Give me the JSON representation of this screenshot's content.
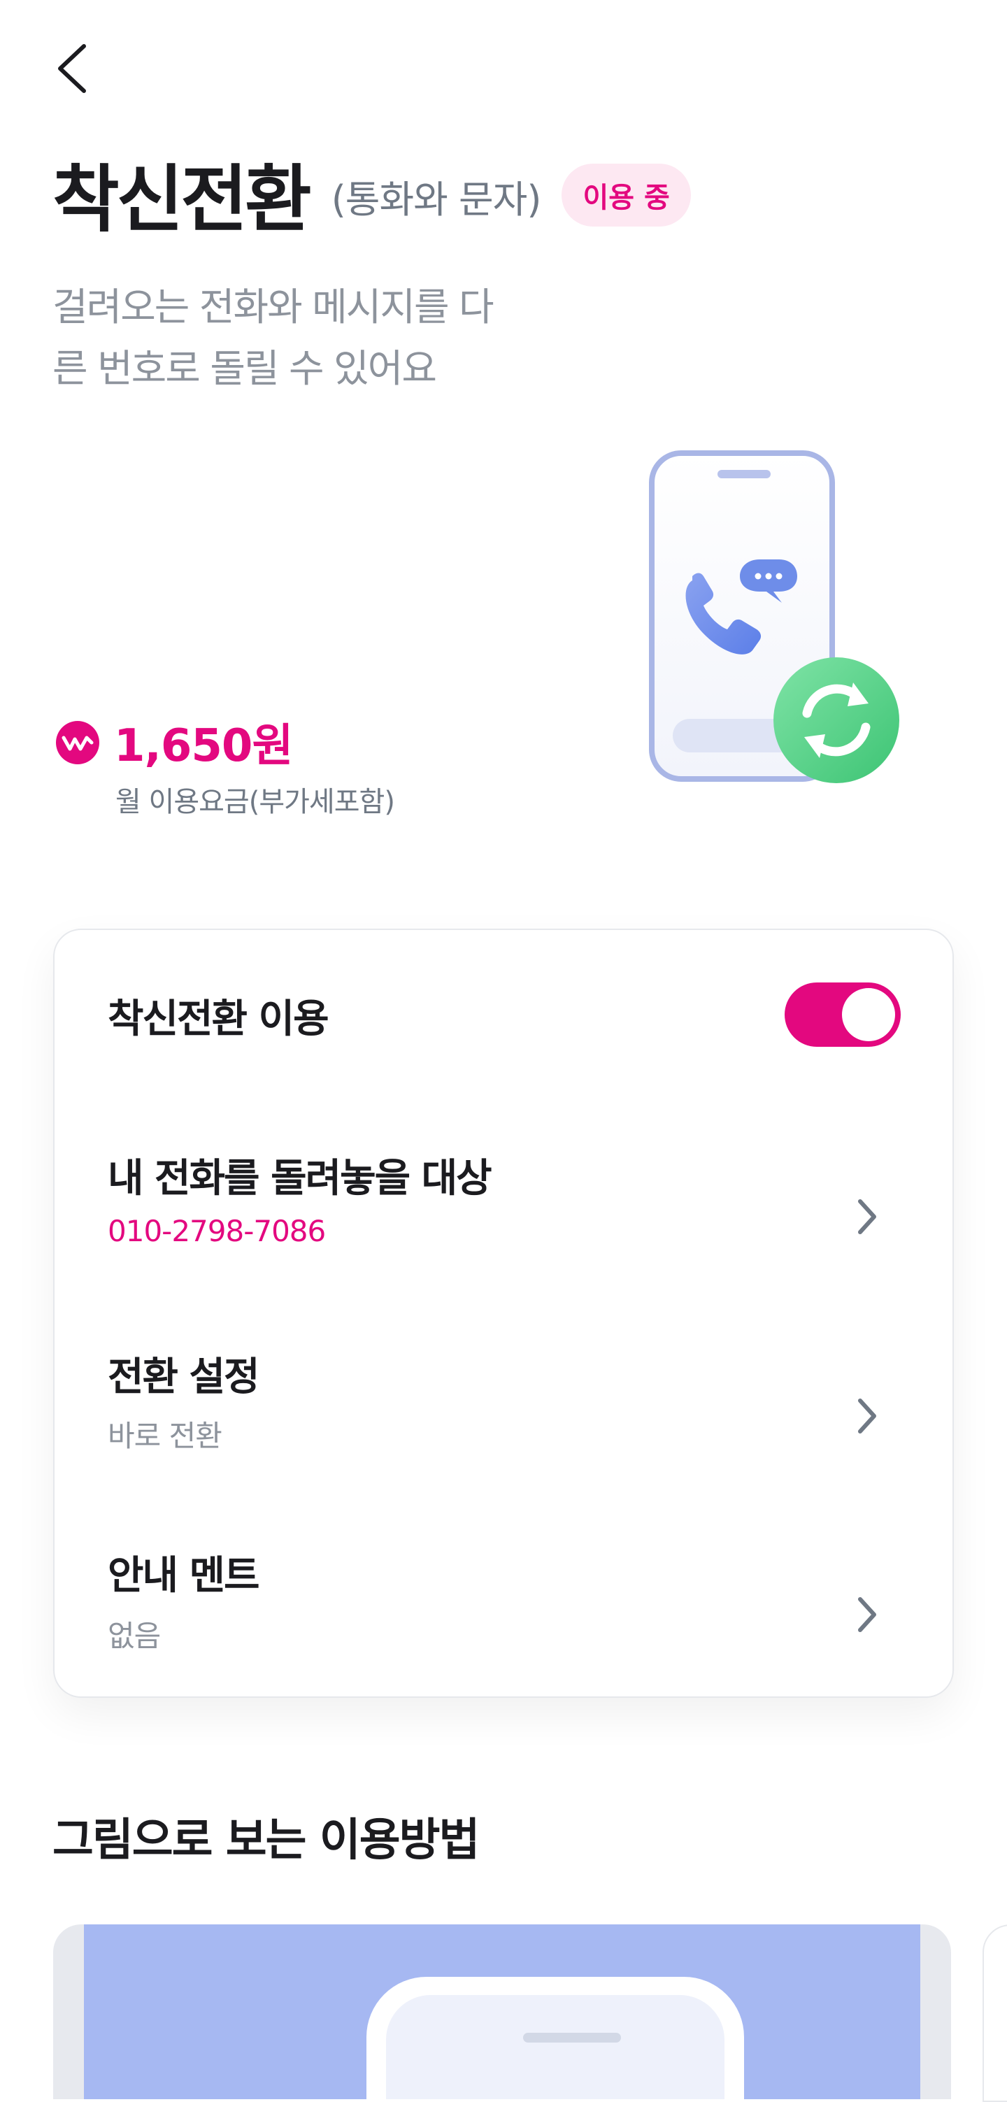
{
  "header": {
    "title": "착신전환",
    "subtitle": "(통화와 문자)",
    "status_badge": "이용 중",
    "description_line1": "걸려오는 전화와 메시지를 다",
    "description_line2": "른 번호로 돌릴 수 있어요"
  },
  "price": {
    "amount": "1,650원",
    "note": "월 이용요금(부가세포함)"
  },
  "settings": {
    "toggle_label": "착신전환 이용",
    "toggle_on": true,
    "rows": [
      {
        "label": "내 전화를 돌려놓을 대상",
        "value": "010-2798-7086"
      },
      {
        "label": "전환 설정",
        "value": "바로 전환"
      },
      {
        "label": "안내 멘트",
        "value": "없음"
      }
    ]
  },
  "guide": {
    "title": "그림으로 보는 이용방법"
  },
  "icons": {
    "back": "chevron-left-icon",
    "price": "won-coin-icon",
    "row_arrow": "chevron-right-icon",
    "hero": "phone-forwarding-illustration"
  },
  "colors": {
    "accent": "#e3087f",
    "badge_bg": "#fde8f2",
    "muted_text": "#8d939c",
    "hero_green": "#4fcf7e",
    "guide_blue": "#a6b8f2"
  }
}
